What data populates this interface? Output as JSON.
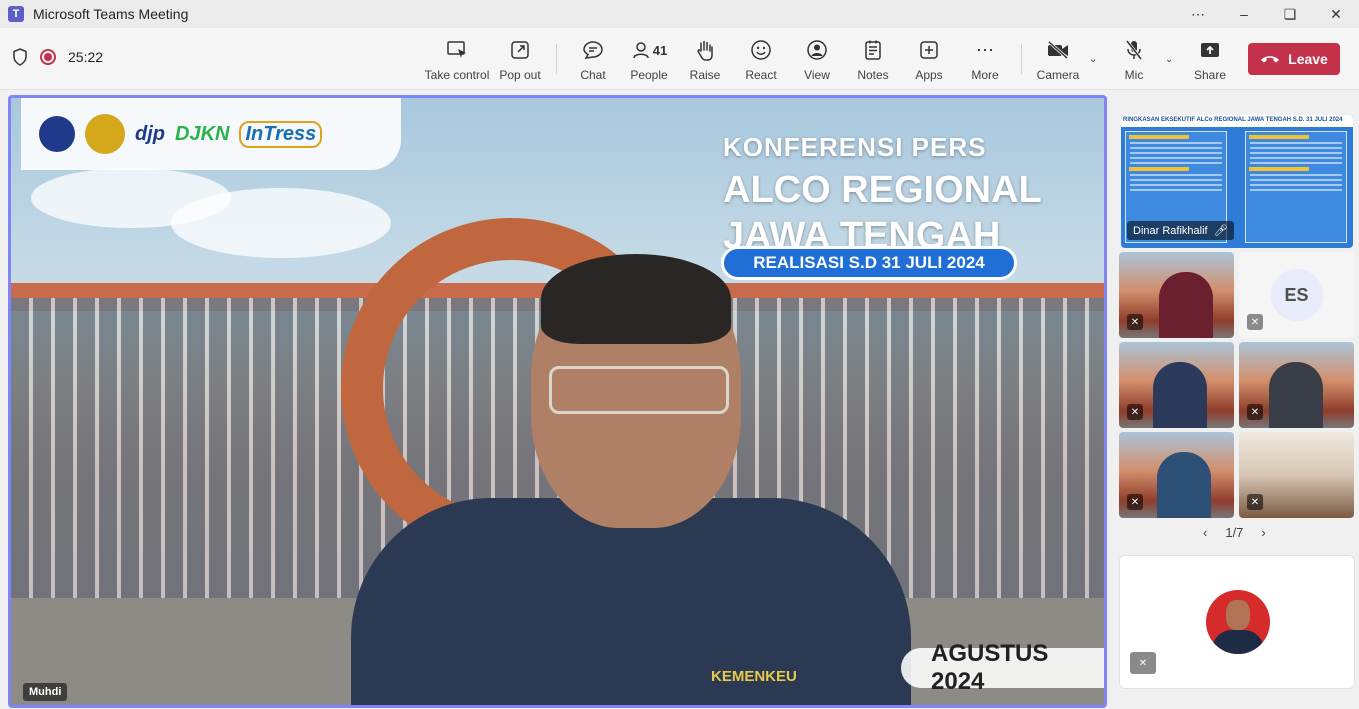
{
  "window": {
    "title": "Microsoft Teams Meeting",
    "app_icon": "T"
  },
  "toolbar": {
    "timer": "25:22",
    "take_control": "Take control",
    "pop_out": "Pop out",
    "chat": "Chat",
    "people": "People",
    "people_count": "41",
    "raise": "Raise",
    "react": "React",
    "view": "View",
    "notes": "Notes",
    "apps": "Apps",
    "more": "More",
    "camera": "Camera",
    "mic": "Mic",
    "share": "Share",
    "leave": "Leave",
    "leave_color": "#c4314b"
  },
  "main": {
    "speaker_name": "Muhdi",
    "logos": [
      "djp",
      "DJKN",
      "InTress"
    ],
    "headline_small": "KONFERENSI PERS",
    "headline_line1": "ALCO REGIONAL",
    "headline_line2": "JAWA TENGAH",
    "realisasi": "REALISASI S.D 31 JULI 2024",
    "date_banner": "AGUSTUS 2024",
    "shirt_text": "KEMENKEU",
    "highlight_color": "#7f85f5"
  },
  "sidebar": {
    "shared_tile": {
      "title": "RINGKASAN EKSEKUTIF ALCo REGIONAL JAWA TENGAH S.D. 31 JULI 2024",
      "name": "Dinar Rafikhalif"
    },
    "es_initials": "ES",
    "pager": "1/7"
  }
}
